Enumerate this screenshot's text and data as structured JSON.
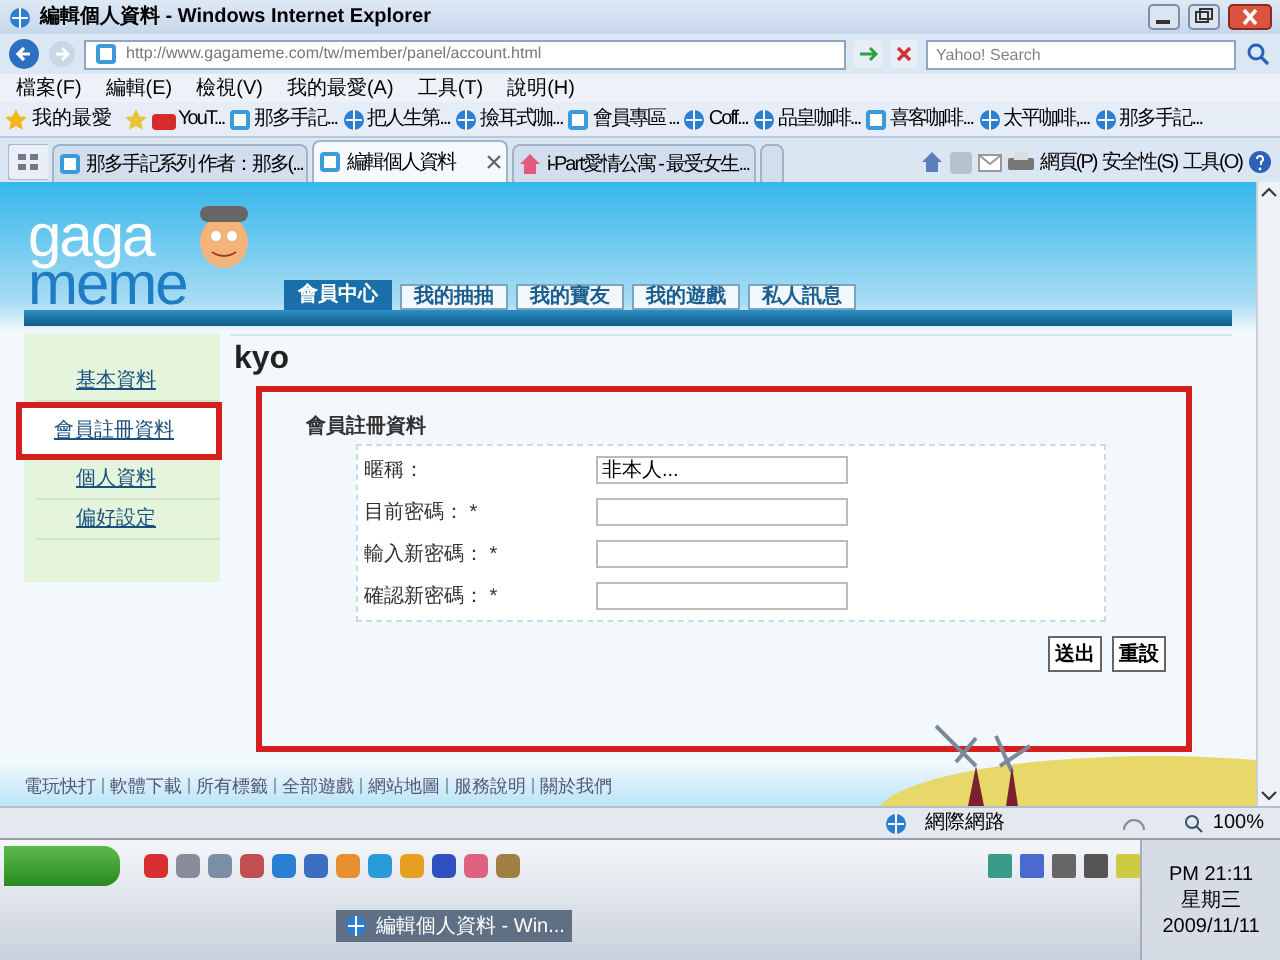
{
  "window": {
    "title": "編輯個人資料 - Windows Internet Explorer"
  },
  "address_bar": {
    "url": "http://www.gagameme.com/tw/member/panel/account.html",
    "search_placeholder": "Yahoo! Search"
  },
  "menu": [
    "檔案(F)",
    "編輯(E)",
    "檢視(V)",
    "我的最愛(A)",
    "工具(T)",
    "說明(H)"
  ],
  "favorites": {
    "label": "我的最愛",
    "items": [
      "YouT...",
      "那多手記...",
      "把人生第...",
      "撿耳式咖...",
      "會員專區 ...",
      "Coff...",
      "品皇咖啡...",
      "喜客咖啡...",
      "太平咖啡,...",
      "那多手記..."
    ]
  },
  "browser_tabs": [
    {
      "label": "那多手記系列 作者：那多(...",
      "selected": false
    },
    {
      "label": "編輯個人資料",
      "selected": true
    },
    {
      "label": "i-Part愛情公寓 - 最受女生...",
      "selected": false
    }
  ],
  "command_bar": [
    "網頁(P)",
    "安全性(S)",
    "工具(O)"
  ],
  "site": {
    "logo": {
      "line1": "gaga",
      "line2": "meme"
    },
    "nav_tabs": [
      {
        "label": "會員中心",
        "selected": true
      },
      {
        "label": "我的抽抽",
        "selected": false
      },
      {
        "label": "我的寶友",
        "selected": false
      },
      {
        "label": "我的遊戲",
        "selected": false
      },
      {
        "label": "私人訊息",
        "selected": false
      }
    ],
    "sidebar": [
      {
        "label": "基本資料",
        "selected": false
      },
      {
        "label": "會員註冊資料",
        "selected": true
      },
      {
        "label": "個人資料",
        "selected": false
      },
      {
        "label": "偏好設定",
        "selected": false
      }
    ],
    "username": "kyo",
    "form": {
      "title": "會員註冊資料",
      "fields": [
        {
          "label": "暱稱：",
          "value": "非本人..."
        },
        {
          "label": "目前密碼： *"
        },
        {
          "label": "輸入新密碼： *"
        },
        {
          "label": "確認新密碼： *"
        }
      ],
      "buttons": [
        "送出",
        "重設"
      ]
    },
    "footer_links": [
      "電玩快打",
      "軟體下載",
      "所有標籤",
      "全部遊戲",
      "網站地圖",
      "服務說明",
      "關於我們"
    ]
  },
  "status_bar": {
    "zone": "網際網路",
    "zoom": "100%"
  },
  "taskbar": {
    "task": "編輯個人資料 - Win...",
    "time": "PM 21:11",
    "weekday": "星期三",
    "date": "2009/11/11"
  }
}
